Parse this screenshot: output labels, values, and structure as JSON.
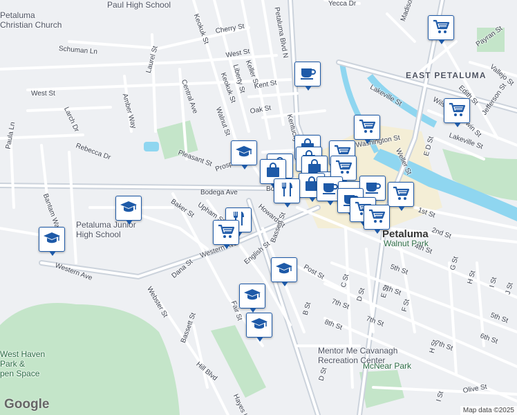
{
  "map": {
    "attribution": "Map data ©2025",
    "logo": "Google",
    "colors": {
      "background": "#eef0f3",
      "road": "#ffffff",
      "major_road": "#ccd3dc",
      "water": "#8fd6f0",
      "park": "#c4e5c9",
      "downtown": "#f4eed6",
      "marker_border": "#1e5aa8"
    },
    "area_labels": [
      {
        "text": "EAST PETALUMA",
        "kind": "area"
      },
      {
        "text": "Petaluma",
        "kind": "city"
      },
      {
        "text": "Walnut Park",
        "kind": "park"
      },
      {
        "text": "McNear Park",
        "kind": "park"
      },
      {
        "text": "Mentor Me Cavanagh\nRecreation Center",
        "kind": "poi"
      },
      {
        "text": "West Haven\nPark &\npen Space",
        "kind": "park"
      },
      {
        "text": "Petaluma Junior\nHigh School",
        "kind": "poi"
      },
      {
        "text": "Petaluma\nChristian Church",
        "kind": "poi"
      },
      {
        "text": "Paul High School",
        "kind": "poi"
      }
    ],
    "street_labels": [
      "Cherry St",
      "Schuman Ln",
      "Laurel St",
      "Keokuk St",
      "West St",
      "Keller St",
      "Liberty St",
      "Kent St",
      "Keokuk St",
      "Petaluma Blvd N",
      "Madison St",
      "Payran St",
      "Yecca Dr",
      "West St",
      "Larch Dr",
      "Amber Way",
      "Central Ave",
      "Walnut St",
      "Oak St",
      "Kentucky St",
      "Lakeville St",
      "Edith St",
      "Vallejo St",
      "Wilson St",
      "Erwin St",
      "Jefferson St",
      "Lakeville St",
      "Washington St",
      "Weller St",
      "E D St",
      "Rebecca Dr",
      "Paula Ln",
      "Pleasant St",
      "Prospect St",
      "Bodega Ave",
      "Bodega Ave",
      "Bantam Way",
      "Baker St",
      "Upham St",
      "Howard St",
      "1st St",
      "2nd St",
      "Western Ave",
      "English St",
      "Bassett St",
      "4th St",
      "Post St",
      "5th St",
      "Western Ave",
      "Dana St",
      "Webster St",
      "C St",
      "6th St",
      "D St",
      "E St",
      "G St",
      "H St",
      "7th St",
      "F St",
      "I St",
      "J St",
      "Fair St",
      "B St",
      "8th St",
      "7th St",
      "5th St",
      "6th St",
      "Bassett St",
      "Hill Blvd",
      "7th St",
      "H St",
      "Hayes Ln",
      "D St",
      "Olive St",
      "I St"
    ],
    "markers": [
      {
        "type": "grocery",
        "icon": "shopping-cart-icon"
      },
      {
        "type": "cafe",
        "icon": "coffee-cup-icon"
      },
      {
        "type": "grocery",
        "icon": "shopping-cart-icon"
      },
      {
        "type": "grocery",
        "icon": "shopping-cart-icon"
      },
      {
        "type": "school",
        "icon": "graduation-cap-icon"
      },
      {
        "type": "shopping",
        "icon": "shopping-bag-icon"
      },
      {
        "type": "shopping",
        "icon": "shopping-bag-icon"
      },
      {
        "type": "grocery",
        "icon": "shopping-cart-icon"
      },
      {
        "type": "shopping",
        "icon": "shopping-bag-icon"
      },
      {
        "type": "shopping",
        "icon": "shopping-bag-icon"
      },
      {
        "type": "shopping",
        "icon": "shopping-bag-icon"
      },
      {
        "type": "cafe",
        "icon": "coffee-cup-icon"
      },
      {
        "type": "shopping",
        "icon": "shopping-bag-icon"
      },
      {
        "type": "grocery",
        "icon": "shopping-cart-icon"
      },
      {
        "type": "cafe",
        "icon": "coffee-cup-icon"
      },
      {
        "type": "restaurant",
        "icon": "fork-knife-icon"
      },
      {
        "type": "cafe",
        "icon": "coffee-cup-icon"
      },
      {
        "type": "cafe",
        "icon": "coffee-cup-icon"
      },
      {
        "type": "cafe",
        "icon": "coffee-cup-icon"
      },
      {
        "type": "grocery",
        "icon": "shopping-cart-icon"
      },
      {
        "type": "grocery",
        "icon": "shopping-cart-icon"
      },
      {
        "type": "grocery",
        "icon": "shopping-cart-icon"
      },
      {
        "type": "school",
        "icon": "graduation-cap-icon"
      },
      {
        "type": "school",
        "icon": "graduation-cap-icon"
      },
      {
        "type": "restaurant",
        "icon": "fork-knife-icon"
      },
      {
        "type": "grocery",
        "icon": "shopping-cart-icon"
      },
      {
        "type": "school",
        "icon": "graduation-cap-icon"
      },
      {
        "type": "school",
        "icon": "graduation-cap-icon"
      },
      {
        "type": "school",
        "icon": "graduation-cap-icon"
      }
    ]
  }
}
